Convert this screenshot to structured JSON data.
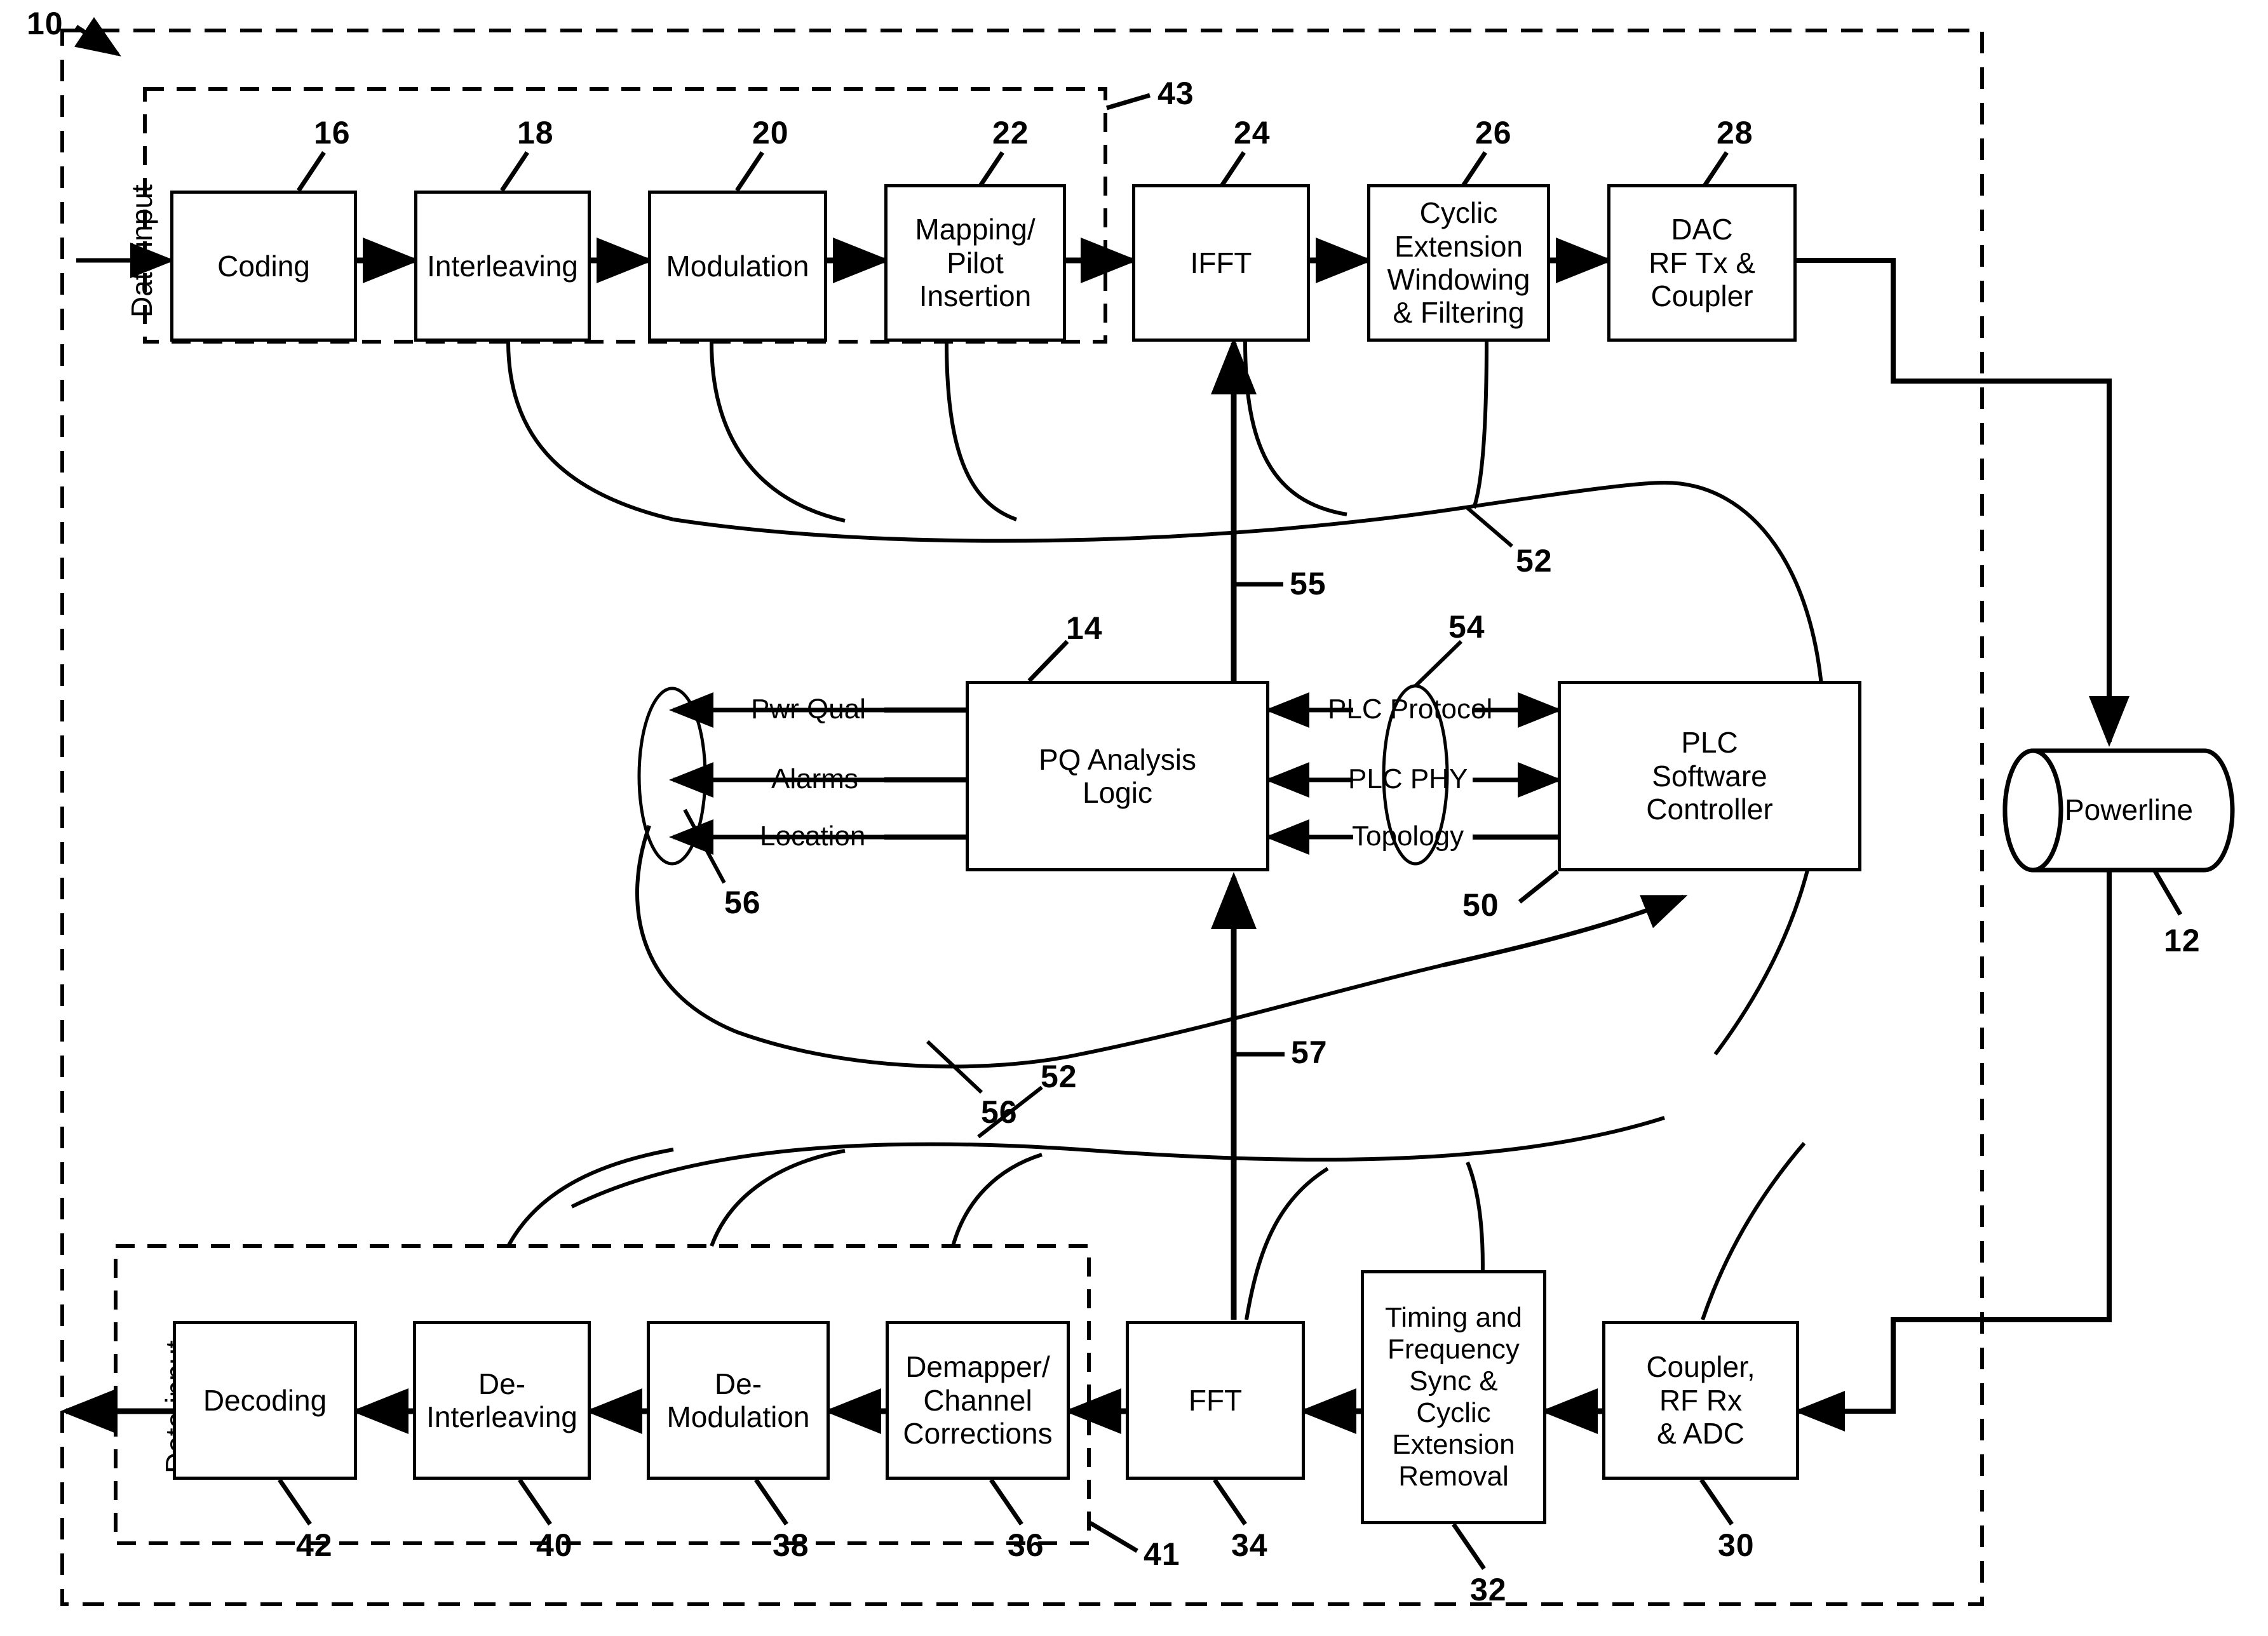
{
  "figure": {
    "system_ref": "10",
    "powerline_ref": "12",
    "powerline_label": "Powerline",
    "tx_chain_ref": "43",
    "rx_chain_ref": "41",
    "data_input_label": "Data input"
  },
  "transmitter": {
    "blocks": [
      {
        "ref": "16",
        "label": "Coding"
      },
      {
        "ref": "18",
        "label": "Interleaving"
      },
      {
        "ref": "20",
        "label": "Modulation"
      },
      {
        "ref": "22",
        "label": "Mapping/\nPilot\nInsertion"
      },
      {
        "ref": "24",
        "label": "IFFT"
      },
      {
        "ref": "26",
        "label": "Cyclic\nExtension\nWindowing\n& Filtering"
      },
      {
        "ref": "28",
        "label": "DAC\nRF Tx &\nCoupler"
      }
    ]
  },
  "receiver": {
    "blocks": [
      {
        "ref": "42",
        "label": "Decoding"
      },
      {
        "ref": "40",
        "label": "De-\nInterleaving"
      },
      {
        "ref": "38",
        "label": "De-\nModulation"
      },
      {
        "ref": "36",
        "label": "Demapper/\nChannel\nCorrections"
      },
      {
        "ref": "34",
        "label": "FFT"
      },
      {
        "ref": "32",
        "label": "Timing and\nFrequency\nSync &\nCyclic\nExtension\nRemoval"
      },
      {
        "ref": "30",
        "label": "Coupler,\nRF Rx\n& ADC"
      }
    ]
  },
  "pq_analysis": {
    "ref": "14",
    "label": "PQ Analysis\nLogic",
    "outputs": [
      "Pwr Qual",
      "Alarms",
      "Location"
    ],
    "outputs_bundle_ref": "56"
  },
  "plc_controller": {
    "ref": "50",
    "label": "PLC\nSoftware\nController",
    "interfaces": [
      "PLC Protocol",
      "PLC PHY",
      "Topology"
    ],
    "interfaces_bundle_ref": "54"
  },
  "connector_refs": {
    "tx_taps": "52",
    "ifft_feed": "55",
    "pq_feedback_upper": "56",
    "pq_feedback_lower": "56",
    "fft_feed": "57",
    "rx_taps": "52"
  }
}
